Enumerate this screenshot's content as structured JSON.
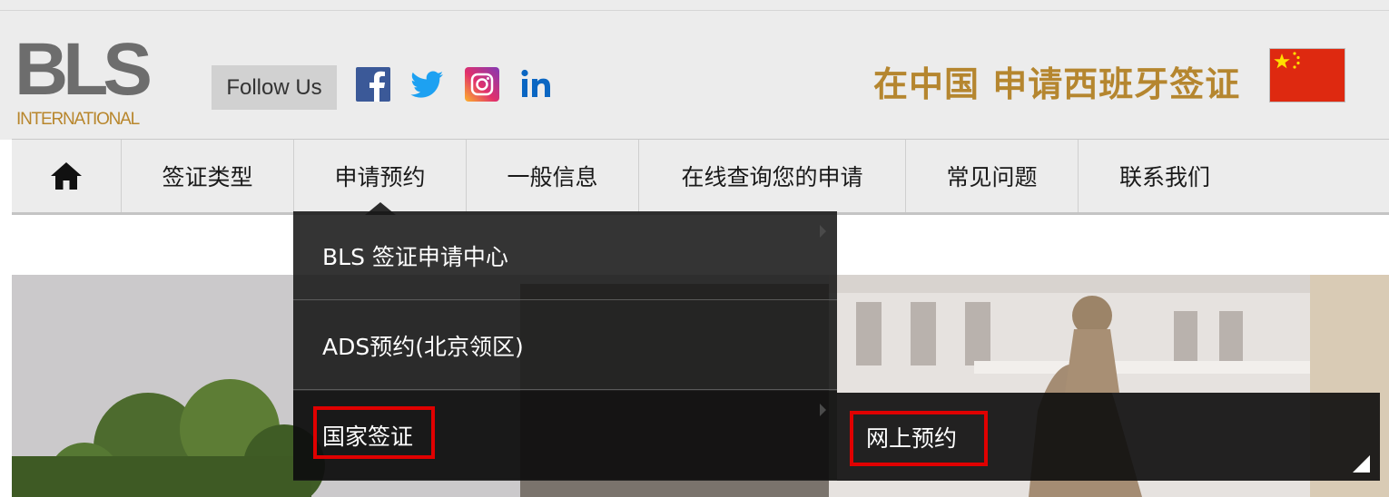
{
  "brand": {
    "logo_letters": "BLS",
    "logo_sub": "INTERNATIONAL"
  },
  "header": {
    "follow_label": "Follow Us",
    "social": [
      "facebook-icon",
      "twitter-icon",
      "instagram-icon",
      "linkedin-icon"
    ],
    "title": "在中国 申请西班牙签证"
  },
  "nav": {
    "items": [
      {
        "label": "签证类型"
      },
      {
        "label": "申请预约"
      },
      {
        "label": "一般信息"
      },
      {
        "label": "在线查询您的申请"
      },
      {
        "label": "常见问题"
      },
      {
        "label": "联系我们"
      }
    ]
  },
  "dropdown": {
    "items": [
      {
        "label": "BLS 签证申请中心"
      },
      {
        "label": "ADS预约(北京领区)"
      },
      {
        "label": "国家签证"
      }
    ],
    "submenu": {
      "label": "网上预约"
    }
  },
  "colors": {
    "accent_gold": "#b5862f",
    "highlight_red": "#e00000",
    "flag_red": "#de2910"
  }
}
